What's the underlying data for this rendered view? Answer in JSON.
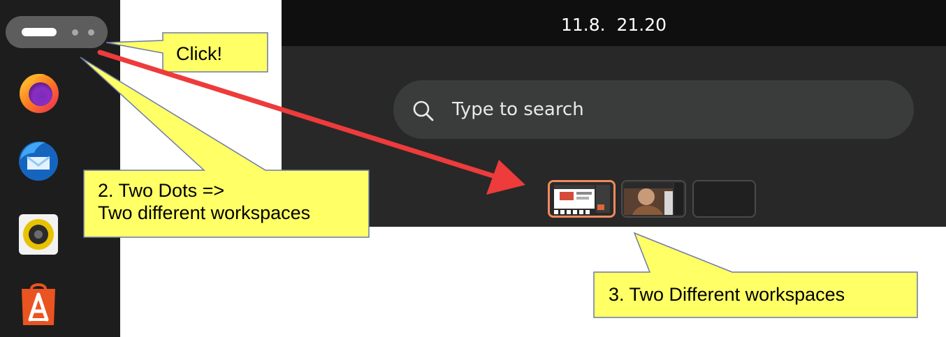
{
  "topbar": {
    "clock": "11.8.  21.20"
  },
  "search": {
    "placeholder": "Type to search"
  },
  "dock": {
    "apps": [
      {
        "name": "Firefox",
        "icon": "firefox-icon"
      },
      {
        "name": "Thunderbird",
        "icon": "thunderbird-icon"
      },
      {
        "name": "Rhythmbox",
        "icon": "rhythmbox-icon"
      },
      {
        "name": "App Center",
        "icon": "app-center-icon"
      }
    ]
  },
  "workspaces": [
    {
      "label": "Workspace 1",
      "active": true
    },
    {
      "label": "Workspace 2",
      "active": false
    },
    {
      "label": "Workspace 3",
      "active": false
    }
  ],
  "annotations": {
    "click": "Click!",
    "two_dots": "2. Two Dots =>\nTwo different workspaces",
    "two_workspaces": "3. Two Different workspaces"
  },
  "colors": {
    "callout_fill": "#ffff66",
    "arrow": "#ee3b3b",
    "active_workspace_border": "#f08a5d",
    "dock_bg": "#1d1d1d",
    "overview_bg": "#282828"
  }
}
